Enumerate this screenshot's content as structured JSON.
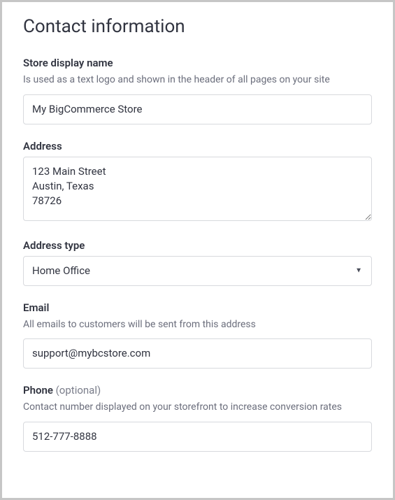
{
  "title": "Contact information",
  "fields": {
    "storeName": {
      "label": "Store display name",
      "description": "Is used as a text logo and shown in the header of all pages on your site",
      "value": "My BigCommerce Store"
    },
    "address": {
      "label": "Address",
      "value": "123 Main Street\nAustin, Texas\n78726"
    },
    "addressType": {
      "label": "Address type",
      "value": "Home Office"
    },
    "email": {
      "label": "Email",
      "description": "All emails to customers will be sent from this address",
      "value": "support@mybcstore.com"
    },
    "phone": {
      "label": "Phone",
      "optional": "(optional)",
      "description": "Contact number displayed on your storefront to increase conversion rates",
      "value": "512-777-8888"
    }
  }
}
